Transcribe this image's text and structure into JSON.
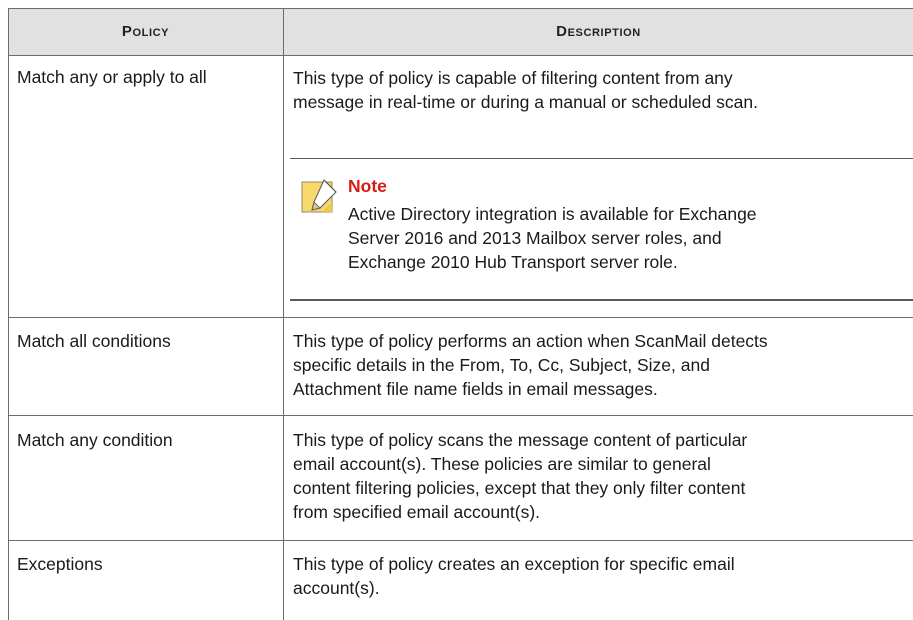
{
  "table": {
    "headers": {
      "policy": "Policy",
      "description": "Description"
    },
    "rows": [
      {
        "policy": "Match any or apply to all",
        "description_lines": [
          "This type of policy is capable of filtering content from any",
          "message in real-time or during a manual or scheduled scan."
        ]
      },
      {
        "policy": "Match all conditions",
        "description_lines": [
          "This type of policy performs an action when ScanMail detects",
          "specific details in the From, To, Cc, Subject, Size, and",
          "Attachment file name fields in email messages."
        ]
      },
      {
        "policy": "Match any condition",
        "description_lines": [
          "This type of policy scans the message content of particular",
          "email account(s). These policies are similar to general",
          "content filtering policies, except that they only filter content",
          "from specified email account(s)."
        ]
      },
      {
        "policy": "Exceptions",
        "description_lines": [
          "This type of policy creates an exception for specific email",
          "account(s)."
        ]
      }
    ]
  },
  "note": {
    "label": "Note",
    "icon": "note-pencil-icon",
    "lines": [
      "Active Directory integration is available for Exchange",
      "Server 2016 and 2013 Mailbox server roles, and",
      "Exchange 2010 Hub Transport server role."
    ]
  },
  "colors": {
    "header_bg": "#e1e1e1",
    "note_label": "#d81b12",
    "note_icon_fill": "#f7d96b",
    "rule": "#6b6b6b"
  }
}
